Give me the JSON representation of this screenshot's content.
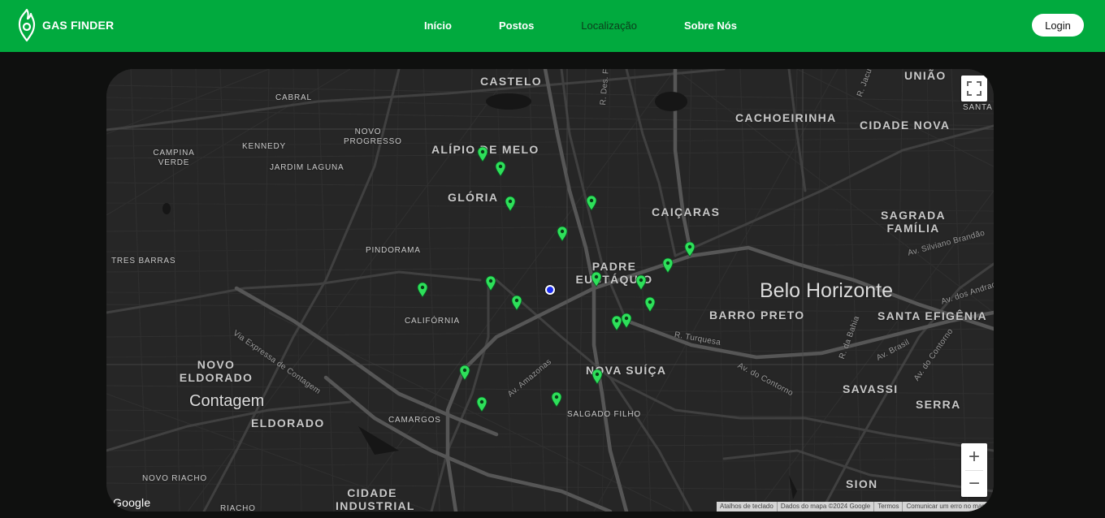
{
  "brand": {
    "name": "GAS FINDER",
    "logo_icon": "flame-location-pin-icon"
  },
  "nav": {
    "items": [
      {
        "label": "Início",
        "active": false
      },
      {
        "label": "Postos",
        "active": false
      },
      {
        "label": "Localização",
        "active": true
      },
      {
        "label": "Sobre Nós",
        "active": false
      }
    ],
    "login_label": "Login"
  },
  "colors": {
    "header": "#01aa3e",
    "page_bg": "#0f100f",
    "map_bg": "#262626",
    "pin": "#2ee05a",
    "user_location": "#1b2cf0"
  },
  "map": {
    "neighborhoods": {
      "castelo": "CASTELO",
      "uniao": "UNIÃO",
      "cabral": "CABRAL",
      "cachoeirinha": "CACHOEIRINHA",
      "cidade_nova": "CIDADE NOVA",
      "santa": "SANTA",
      "novo_progresso": "NOVO PROGRESSO",
      "kennedy": "KENNEDY",
      "campina_verde": "CAMPINA VERDE",
      "jardim_laguna": "JARDIM LAGUNA",
      "alipio_de_melo": "ALÍPIO DE MELO",
      "gloria": "GLÓRIA",
      "caicaras": "CAIÇARAS",
      "sagrada_familia": "SAGRADA FAMÍLIA",
      "pindorama": "PINDORAMA",
      "tres_barras": "TRES BARRAS",
      "padre_eustaquio": "PADRE EUSTÁQUIO",
      "barro_preto": "BARRO PRETO",
      "santa_efigenia": "SANTA EFIGÊNIA",
      "california": "CALIFÓRNIA",
      "novo_eldorado": "NOVO ELDORADO",
      "nova_suica": "NOVA SUÍÇA",
      "savassi": "SAVASSI",
      "serra": "SERRA",
      "eldorado": "ELDORADO",
      "camargos": "CAMARGOS",
      "salgado_filho": "SALGADO FILHO",
      "novo_riacho": "NOVO RIACHO",
      "cidade_industrial": "CIDADE INDUSTRIAL",
      "riacho": "RIACHO",
      "sion": "SION"
    },
    "cities": {
      "belo_horizonte": "Belo Horizonte",
      "contagem": "Contagem"
    },
    "streets": {
      "via_expressa": "Via Expressa de Contagem",
      "av_amazonas": "Av. Amazonas",
      "r_turquesa": "R. Turquesa",
      "av_do_contorno": "Av. do Contorno",
      "av_silviano_brandao": "Av. Silviano Brandão",
      "r_da_bahia": "R. da Bahia",
      "av_brasil": "Av. Brasil",
      "av_do_contorno_2": "Av. do Contorno",
      "av_andradas": "Av. dos Andradas",
      "r_des": "R. Des. F",
      "r_jacu": "R. Jacu"
    },
    "pin_count": 20,
    "controls": {
      "fullscreen_icon": "fullscreen-icon",
      "zoom_in": "+",
      "zoom_out": "−"
    },
    "google_logo": "Google",
    "attribution": {
      "shortcuts": "Atalhos de teclado",
      "map_data": "Dados do mapa ©2024 Google",
      "terms": "Termos",
      "report": "Comunicar um erro no mapa"
    }
  }
}
